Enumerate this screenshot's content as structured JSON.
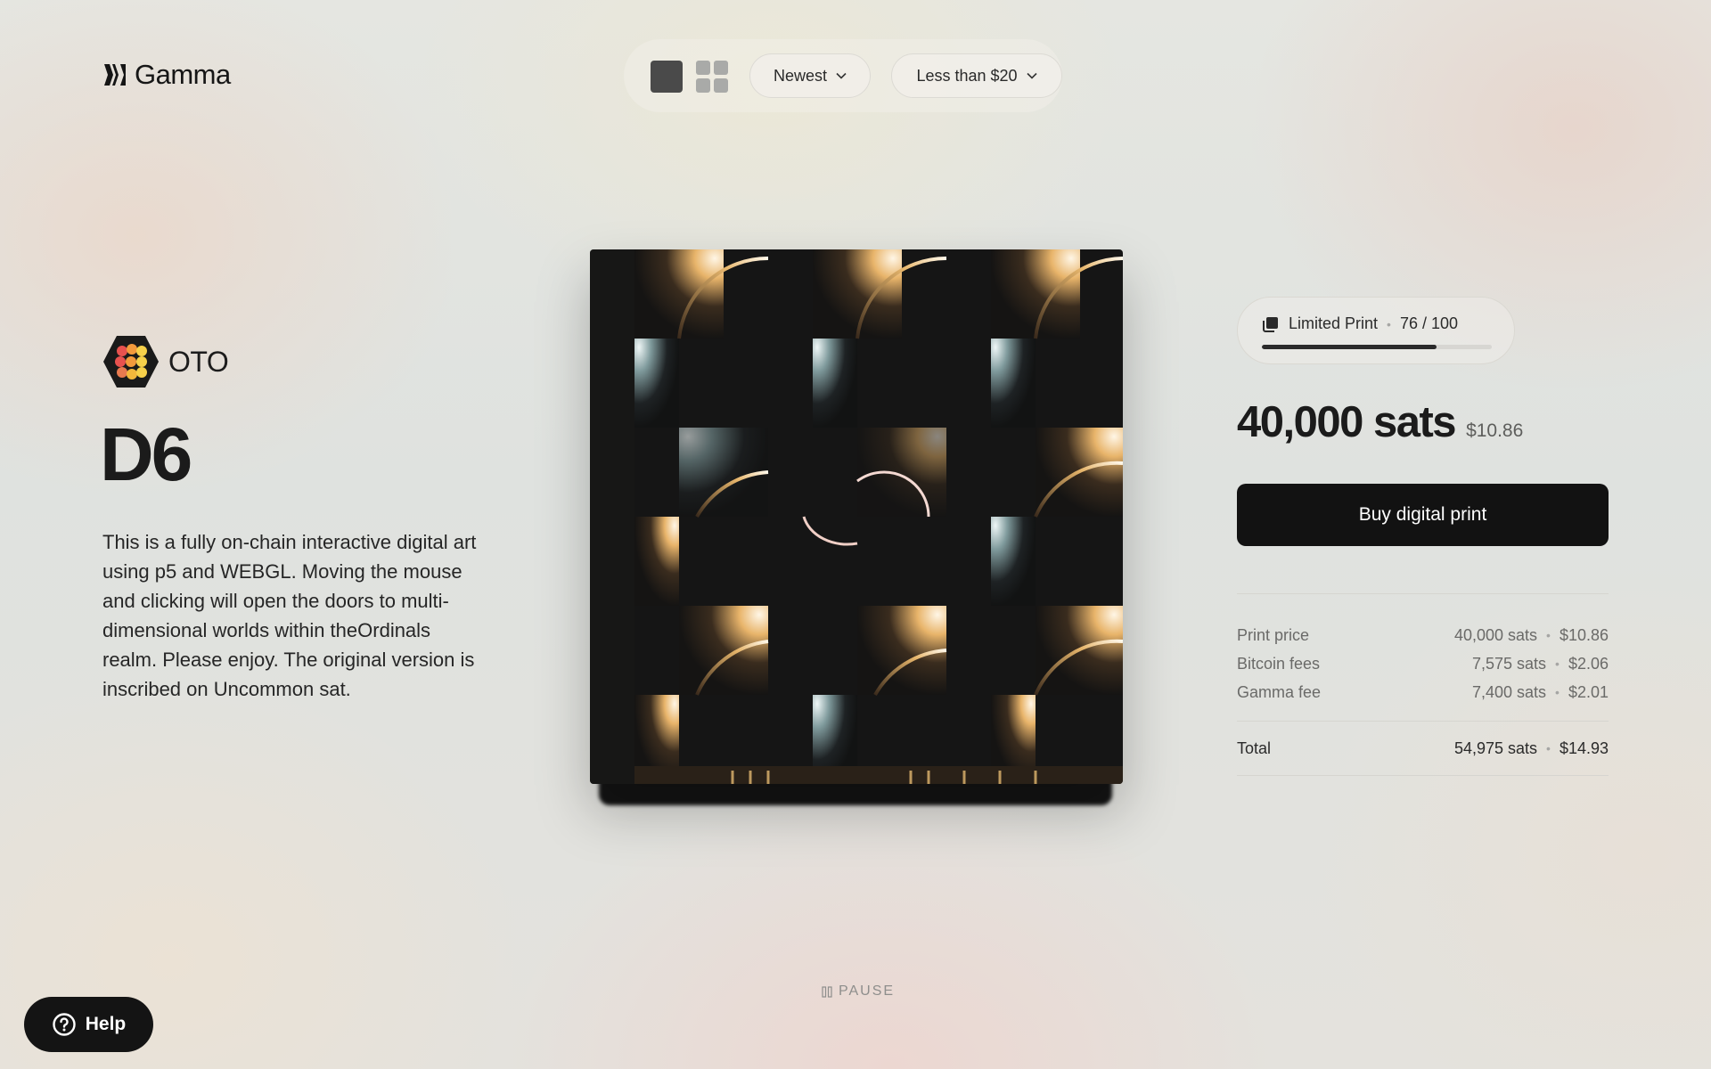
{
  "brand": {
    "name": "Gamma"
  },
  "toolbar": {
    "view_single_icon": "single-view-icon",
    "view_grid_icon": "grid-view-icon",
    "sort_label": "Newest",
    "price_filter_label": "Less than $20"
  },
  "artwork": {
    "artist": "OTO",
    "title": "D6",
    "description": "This is a fully on-chain interactive digital art using p5 and WEBGL. Moving the mouse and clicking will open the doors to multi-dimensional worlds within theOrdinals realm. Please enjoy. The original version is inscribed on Uncommon sat."
  },
  "player": {
    "pause_label": "PAUSE"
  },
  "edition": {
    "label": "Limited Print",
    "count_text": "76 / 100",
    "progress": 0.76
  },
  "price": {
    "sats": "40,000 sats",
    "usd": "$10.86",
    "buy_label": "Buy digital print"
  },
  "breakdown": {
    "rows": [
      {
        "label": "Print price",
        "sats": "40,000 sats",
        "usd": "$10.86"
      },
      {
        "label": "Bitcoin fees",
        "sats": "7,575 sats",
        "usd": "$2.06"
      },
      {
        "label": "Gamma fee",
        "sats": "7,400 sats",
        "usd": "$2.01"
      }
    ],
    "total": {
      "label": "Total",
      "sats": "54,975 sats",
      "usd": "$14.93"
    }
  },
  "help": {
    "label": "Help"
  },
  "colors": {
    "button_dark": "#121212",
    "avatar_dark": "#1a1a1a",
    "avatar_red": "#e8524f",
    "avatar_orange": "#f39a3c",
    "avatar_yellow": "#f6d04a"
  }
}
